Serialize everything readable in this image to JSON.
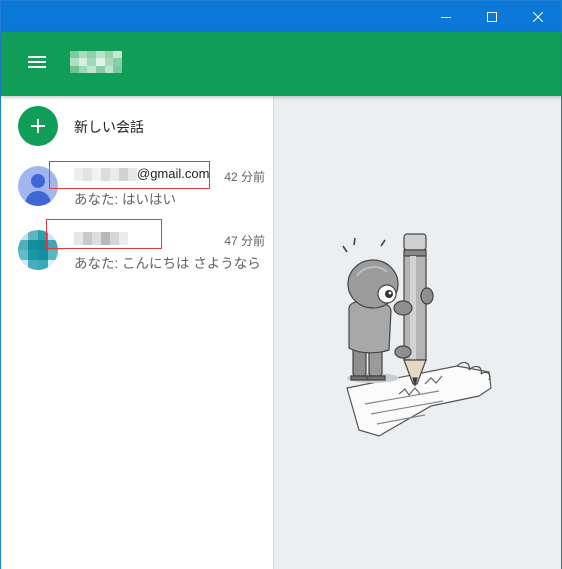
{
  "window": {
    "controls": [
      "minimize-icon",
      "maximize-icon",
      "close-icon"
    ]
  },
  "colors": {
    "titlebar": "#0b78d7",
    "appbar": "#0f9d58",
    "accent": "#0f9d58",
    "highlight_box": "#e8383d",
    "content_bg": "#eceff1"
  },
  "appbar": {
    "menu_icon": "hamburger-menu-icon",
    "title": "[blurred]"
  },
  "sidebar": {
    "new_conversation": {
      "icon": "plus-icon",
      "label": "新しい会話"
    },
    "conversations": [
      {
        "name_suffix": "@gmail.com",
        "time": "42 分前",
        "preview": "あなた: はいはい",
        "avatar": "default-person-avatar"
      },
      {
        "time": "47 分前",
        "preview": "あなた: こんにちは さようなら",
        "avatar": "blurred-photo-avatar"
      }
    ]
  },
  "content": {
    "illustration": "ninja-writing-with-pencil-illustration"
  }
}
